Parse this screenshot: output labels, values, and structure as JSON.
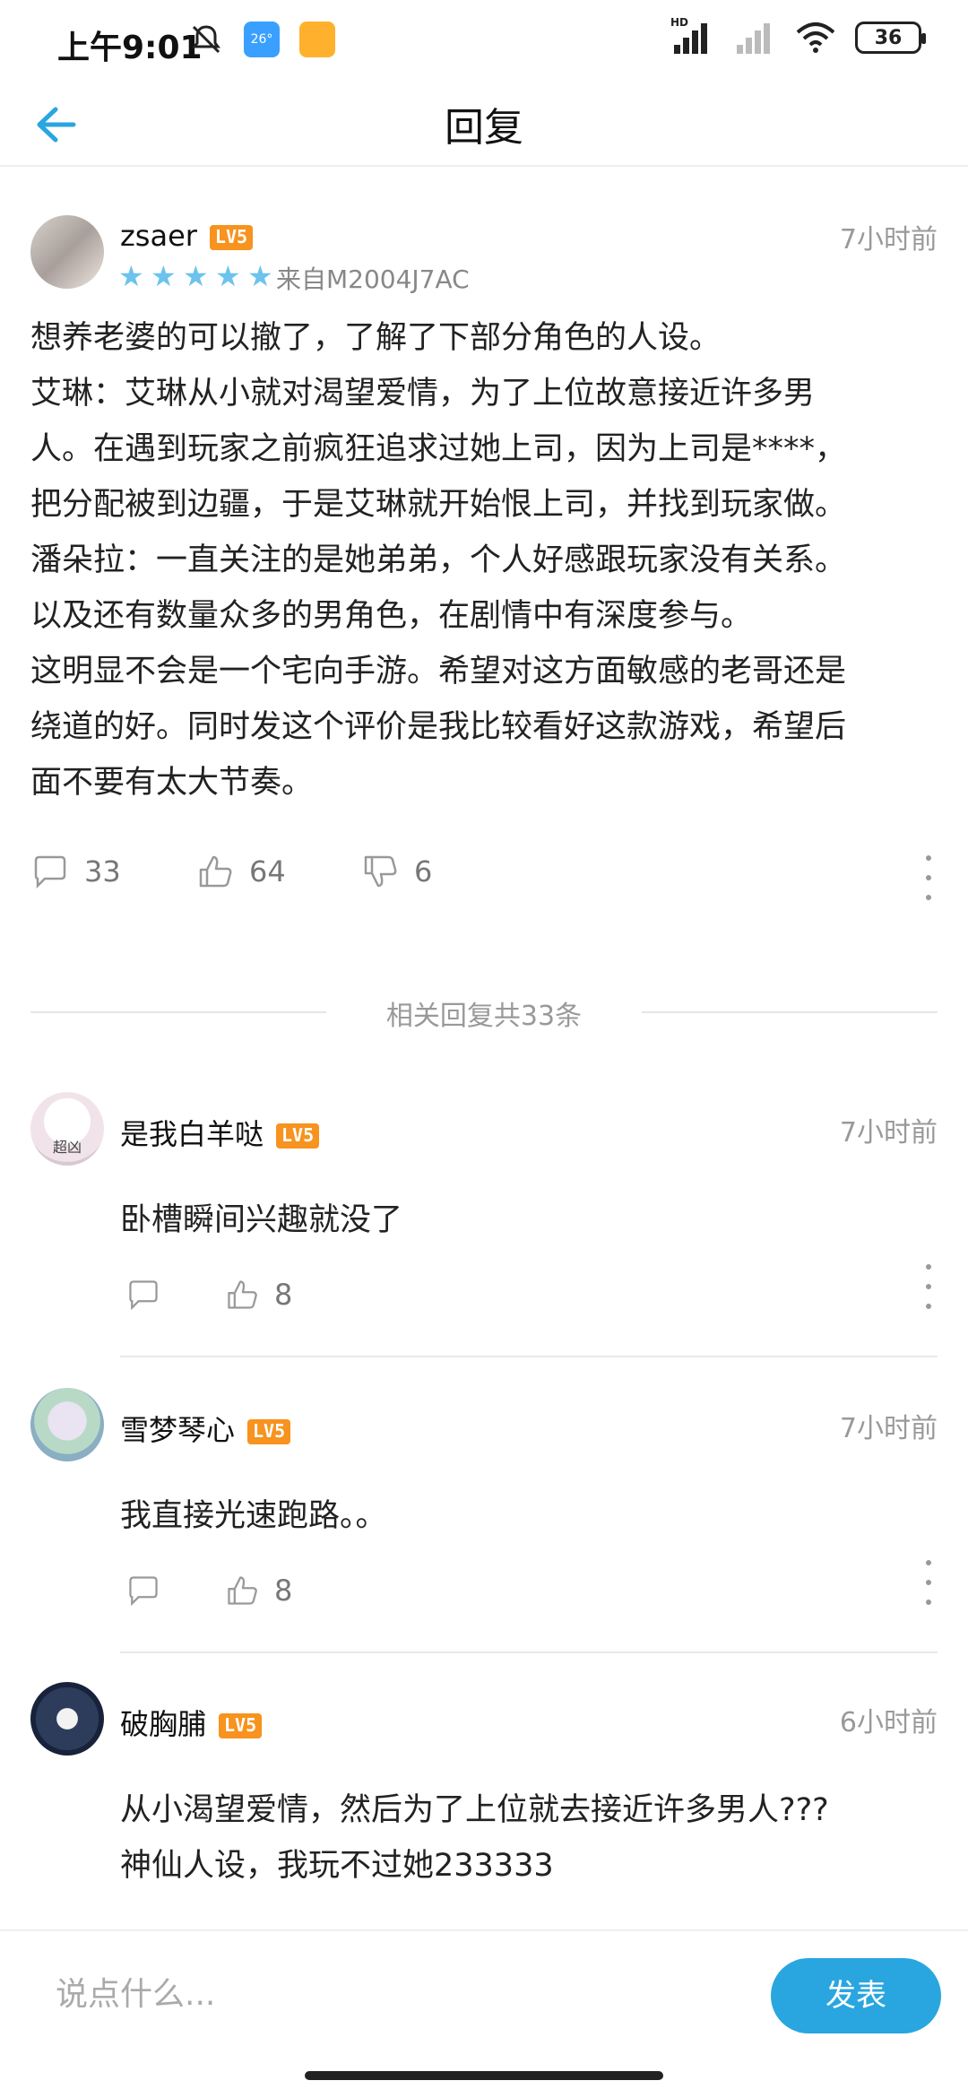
{
  "status_bar": {
    "time": "上午9:01",
    "weather_temp": "26°",
    "battery": "36",
    "network_label": "HD"
  },
  "header": {
    "title": "回复"
  },
  "post": {
    "username": "zsaer",
    "level": "LV5",
    "stars": 5,
    "device": "来自M2004J7AC",
    "time": "7小时前",
    "body_lines": [
      "想养老婆的可以撤了，了解了下部分角色的人设。",
      "艾琳：艾琳从小就对渴望爱情，为了上位故意接近许多男",
      "人。在遇到玩家之前疯狂追求过她上司，因为上司是****，",
      "把分配被到边疆，于是艾琳就开始恨上司，并找到玩家做。",
      "潘朵拉：一直关注的是她弟弟，个人好感跟玩家没有关系。",
      "以及还有数量众多的男角色，在剧情中有深度参与。",
      "这明显不会是一个宅向手游。希望对这方面敏感的老哥还是",
      "绕道的好。同时发这个评价是我比较看好这款游戏，希望后",
      "面不要有太大节奏。"
    ],
    "comments": "33",
    "likes": "64",
    "dislikes": "6"
  },
  "divider_label": "相关回复共33条",
  "replies": [
    {
      "username": "是我白羊哒",
      "level": "LV5",
      "time": "7小时前",
      "avatar_text": "超凶",
      "lines": [
        "卧槽瞬间兴趣就没了"
      ],
      "likes": "8"
    },
    {
      "username": "雪梦琴心",
      "level": "LV5",
      "time": "7小时前",
      "lines": [
        "我直接光速跑路。。"
      ],
      "likes": "8"
    },
    {
      "username": "破胸脯",
      "level": "LV5",
      "time": "6小时前",
      "lines": [
        "从小渴望爱情，然后为了上位就去接近许多男人???",
        "神仙人设，我玩不过她233333"
      ]
    }
  ],
  "composer": {
    "placeholder": "说点什么...",
    "send_label": "发表"
  },
  "colors": {
    "accent": "#29a6e0",
    "level_badge": "#f7931e",
    "star": "#6cc3ee"
  }
}
